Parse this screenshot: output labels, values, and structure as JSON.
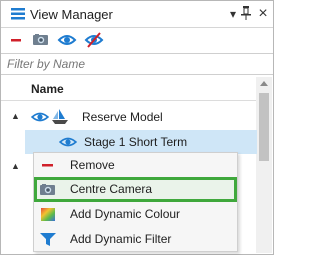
{
  "window": {
    "title": "View Manager",
    "pin_glyph": "−†",
    "close_glyph": "×",
    "icons": [
      "view-manager-icon",
      "pin-icon",
      "close-icon"
    ]
  },
  "toolbar": {
    "tools": [
      "remove-icon",
      "camera-icon",
      "show-icon",
      "hide-icon"
    ]
  },
  "filter": {
    "placeholder": "Filter by Name",
    "value": ""
  },
  "table": {
    "column_header": "Name"
  },
  "tree": {
    "rows": [
      {
        "label": "Reserve Model",
        "expanded": true,
        "visible": true,
        "icon": "model-ship-icon"
      },
      {
        "label": "Stage 1 Short Term",
        "visible": true,
        "selected": true
      }
    ]
  },
  "context_menu": {
    "items": [
      {
        "label": "Remove",
        "icon": "remove-icon"
      },
      {
        "label": "Centre Camera",
        "icon": "camera-icon",
        "highlighted": true
      },
      {
        "label": "Add Dynamic Colour",
        "icon": "colour-swatch-icon"
      },
      {
        "label": "Add Dynamic Filter",
        "icon": "filter-icon"
      }
    ],
    "highlight_color": "#3fa83c"
  },
  "colors": {
    "accent_blue": "#1f7cd0",
    "remove_red": "#d0202a",
    "selected_row": "#cfe6f7"
  }
}
